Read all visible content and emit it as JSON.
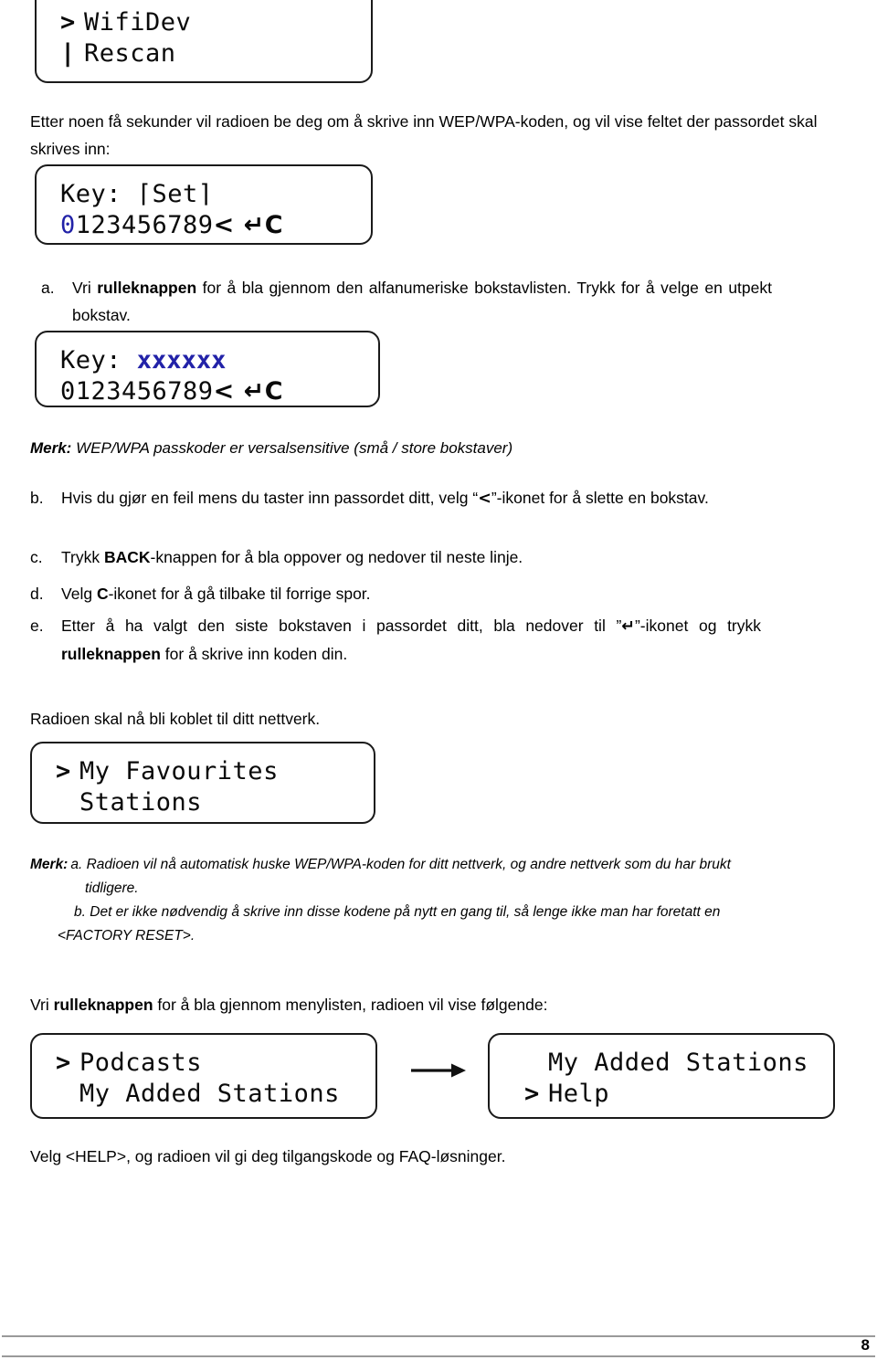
{
  "page": {
    "number": "8",
    "language": "Norwegian"
  },
  "colors": {
    "text": "#000000",
    "lcd_border": "#1a1a1a",
    "highlight_blue": "#2222a8",
    "footer_rule": "#9a9a9a"
  },
  "intro": {
    "text": "Etter noen få sekunder vil radioen be deg om å skrive inn WEP/WPA-koden, og vil vise feltet der passordet skal skrives inn:"
  },
  "displays": {
    "wifidev": {
      "caret": ">",
      "line1": "WifiDev",
      "line2_prefix": "|",
      "line2": "Rescan"
    },
    "key_set": {
      "line1": "Key: ⌈Set⌉",
      "line2_highlight": "0",
      "line2_rest": "123456789",
      "line2_icons": "< ↵C"
    },
    "key_masked": {
      "line1_label": "Key:",
      "line1_value": "xxxxxx",
      "line2": "0123456789",
      "line2_icons": "< ↵C"
    },
    "favourites": {
      "caret": ">",
      "line1": "My Favourites",
      "line2": "Stations"
    },
    "podcasts": {
      "caret": ">",
      "line1": "Podcasts",
      "line2": "My Added Stations"
    },
    "help": {
      "line1": "My Added Stations",
      "caret": ">",
      "line2": "Help"
    },
    "transition_arrow": "→"
  },
  "list": {
    "a": {
      "marker": "a.",
      "pre": "Vri ",
      "bold": "rulleknappen",
      "post": " for å bla gjennom den alfanumeriske bokstavlisten. Trykk for å velge en utpekt bokstav."
    },
    "b": {
      "marker": "b.",
      "pre": "Hvis du gjør en feil mens du taster inn passordet ditt, velg “",
      "icon": "<",
      "post": "”-ikonet for å slette en bokstav."
    },
    "c": {
      "marker": "c.",
      "pre": "Trykk ",
      "bold": "BACK",
      "post": "-knappen for å bla oppover og nedover til neste linje."
    },
    "d": {
      "marker": "d.",
      "pre": "Velg ",
      "bold": "C",
      "post": "-ikonet for å gå tilbake til forrige spor."
    },
    "e": {
      "marker": "e.",
      "pre": "Etter å ha valgt den siste bokstaven i passordet ditt, bla nedover til ”",
      "icon": "↵",
      "mid": "”-ikonet og trykk ",
      "bold": "rulleknappen",
      "post": " for å skrive inn koden din."
    }
  },
  "notes": {
    "case_sensitive": {
      "label": "Merk:",
      "text": "WEP/WPA passkoder er versalsensitive (små / store bokstaver)"
    },
    "block": {
      "label": "Merk:",
      "item_a_marker": "a.",
      "item_a": "Radioen vil nå automatisk huske WEP/WPA-koden for ditt nettverk, og andre nettverk som du har brukt",
      "item_a_cont": "tidligere.",
      "item_b_marker": "b.",
      "item_b": "Det er ikke nødvendig å skrive inn disse kodene på nytt en gang til, så lenge ikke man har foretatt en",
      "item_b_cont": "<FACTORY RESET>."
    }
  },
  "body_text": {
    "radio_connected": "Radioen skal nå bli koblet til ditt nettverk.",
    "vri_menu_pre": "Vri ",
    "vri_menu_bold": "rulleknappen",
    "vri_menu_post": " for å bla gjennom menylisten, radioen vil vise følgende:",
    "velg_help": "Velg <HELP>, og radioen vil gi deg tilgangskode og FAQ-løsninger."
  }
}
